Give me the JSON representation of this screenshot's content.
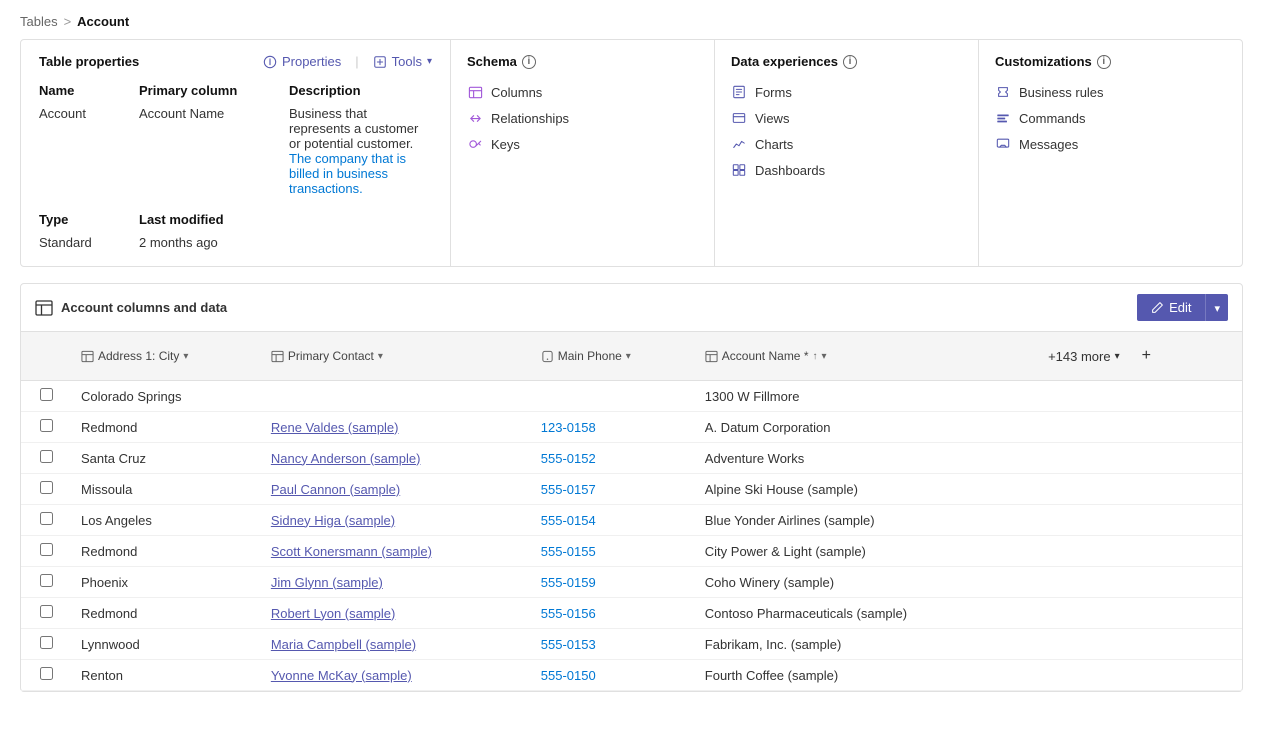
{
  "breadcrumb": {
    "parent": "Tables",
    "separator": ">",
    "current": "Account"
  },
  "tableProperties": {
    "title": "Table properties",
    "actions": {
      "properties": "Properties",
      "tools": "Tools"
    },
    "columns": {
      "col1": "Name",
      "col2": "Primary column",
      "col3": "Description"
    },
    "values": {
      "name": "Account",
      "primaryColumn": "Account Name",
      "type": "Type",
      "typeVal": "Standard",
      "lastModified": "Last modified",
      "lastModifiedVal": "2 months ago",
      "descStart": "Business that represents a customer or potential customer.",
      "descLink": "The company that is billed in business transactions."
    }
  },
  "schema": {
    "title": "Schema",
    "links": [
      {
        "label": "Columns",
        "icon": "grid"
      },
      {
        "label": "Relationships",
        "icon": "arrows"
      },
      {
        "label": "Keys",
        "icon": "key"
      }
    ]
  },
  "dataExperiences": {
    "title": "Data experiences",
    "links": [
      {
        "label": "Forms",
        "icon": "form"
      },
      {
        "label": "Views",
        "icon": "view"
      },
      {
        "label": "Charts",
        "icon": "chart"
      },
      {
        "label": "Dashboards",
        "icon": "dashboard"
      }
    ]
  },
  "customizations": {
    "title": "Customizations",
    "links": [
      {
        "label": "Business rules",
        "icon": "rule"
      },
      {
        "label": "Commands",
        "icon": "command"
      },
      {
        "label": "Messages",
        "icon": "message"
      }
    ]
  },
  "dataSection": {
    "title": "Account columns and data",
    "editLabel": "Edit",
    "moreColumns": "+143 more"
  },
  "tableHeaders": [
    {
      "label": "Address 1: City",
      "sortable": true
    },
    {
      "label": "Primary Contact",
      "sortable": true
    },
    {
      "label": "Main Phone",
      "sortable": true
    },
    {
      "label": "Account Name *",
      "sortable": true,
      "sorted": true
    }
  ],
  "rows": [
    {
      "city": "Colorado Springs",
      "contact": "",
      "phone": "",
      "account": "1300 W Fillmore"
    },
    {
      "city": "Redmond",
      "contact": "Rene Valdes (sample)",
      "phone": "123-0158",
      "account": "A. Datum Corporation"
    },
    {
      "city": "Santa Cruz",
      "contact": "Nancy Anderson (sample)",
      "phone": "555-0152",
      "account": "Adventure Works"
    },
    {
      "city": "Missoula",
      "contact": "Paul Cannon (sample)",
      "phone": "555-0157",
      "account": "Alpine Ski House (sample)"
    },
    {
      "city": "Los Angeles",
      "contact": "Sidney Higa (sample)",
      "phone": "555-0154",
      "account": "Blue Yonder Airlines (sample)"
    },
    {
      "city": "Redmond",
      "contact": "Scott Konersmann (sample)",
      "phone": "555-0155",
      "account": "City Power & Light (sample)"
    },
    {
      "city": "Phoenix",
      "contact": "Jim Glynn (sample)",
      "phone": "555-0159",
      "account": "Coho Winery (sample)"
    },
    {
      "city": "Redmond",
      "contact": "Robert Lyon (sample)",
      "phone": "555-0156",
      "account": "Contoso Pharmaceuticals (sample)"
    },
    {
      "city": "Lynnwood",
      "contact": "Maria Campbell (sample)",
      "phone": "555-0153",
      "account": "Fabrikam, Inc. (sample)"
    },
    {
      "city": "Renton",
      "contact": "Yvonne McKay (sample)",
      "phone": "555-0150",
      "account": "Fourth Coffee (sample)"
    }
  ]
}
